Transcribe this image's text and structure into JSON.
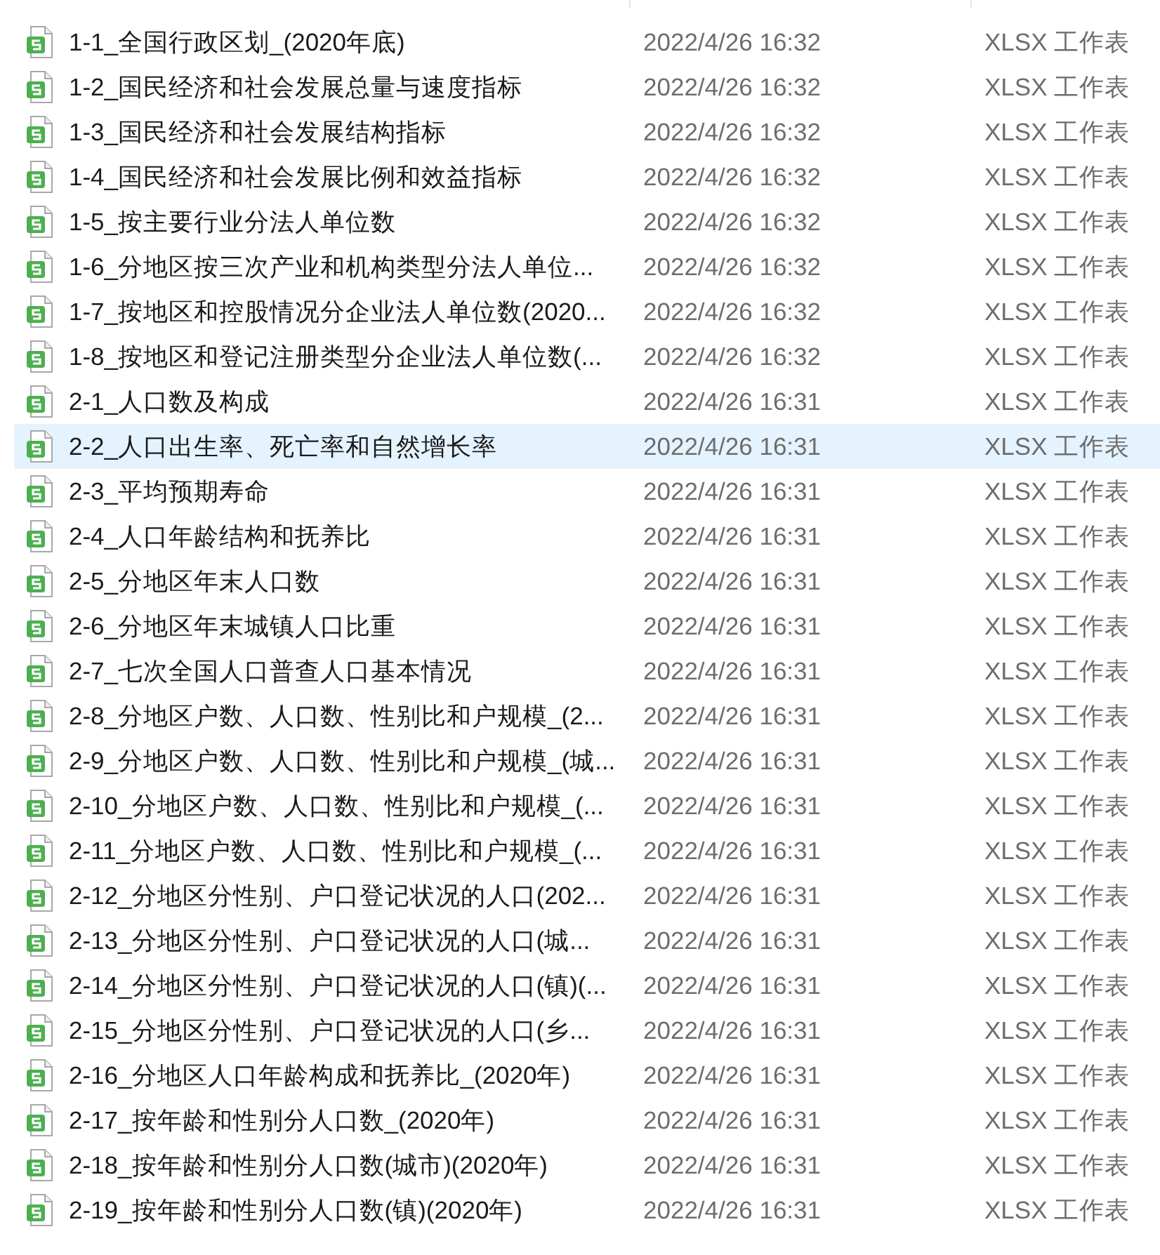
{
  "files": [
    {
      "name": "1-1_全国行政区划_(2020年底)",
      "modified": "2022/4/26 16:32",
      "type": "XLSX 工作表",
      "selected": false
    },
    {
      "name": "1-2_国民经济和社会发展总量与速度指标",
      "modified": "2022/4/26 16:32",
      "type": "XLSX 工作表",
      "selected": false
    },
    {
      "name": "1-3_国民经济和社会发展结构指标",
      "modified": "2022/4/26 16:32",
      "type": "XLSX 工作表",
      "selected": false
    },
    {
      "name": "1-4_国民经济和社会发展比例和效益指标",
      "modified": "2022/4/26 16:32",
      "type": "XLSX 工作表",
      "selected": false
    },
    {
      "name": "1-5_按主要行业分法人单位数",
      "modified": "2022/4/26 16:32",
      "type": "XLSX 工作表",
      "selected": false
    },
    {
      "name": "1-6_分地区按三次产业和机构类型分法人单位...",
      "modified": "2022/4/26 16:32",
      "type": "XLSX 工作表",
      "selected": false
    },
    {
      "name": "1-7_按地区和控股情况分企业法人单位数(2020...",
      "modified": "2022/4/26 16:32",
      "type": "XLSX 工作表",
      "selected": false
    },
    {
      "name": "1-8_按地区和登记注册类型分企业法人单位数(...",
      "modified": "2022/4/26 16:32",
      "type": "XLSX 工作表",
      "selected": false
    },
    {
      "name": "2-1_人口数及构成",
      "modified": "2022/4/26 16:31",
      "type": "XLSX 工作表",
      "selected": false
    },
    {
      "name": "2-2_人口出生率、死亡率和自然增长率",
      "modified": "2022/4/26 16:31",
      "type": "XLSX 工作表",
      "selected": true
    },
    {
      "name": "2-3_平均预期寿命",
      "modified": "2022/4/26 16:31",
      "type": "XLSX 工作表",
      "selected": false
    },
    {
      "name": "2-4_人口年龄结构和抚养比",
      "modified": "2022/4/26 16:31",
      "type": "XLSX 工作表",
      "selected": false
    },
    {
      "name": "2-5_分地区年末人口数",
      "modified": "2022/4/26 16:31",
      "type": "XLSX 工作表",
      "selected": false
    },
    {
      "name": "2-6_分地区年末城镇人口比重",
      "modified": "2022/4/26 16:31",
      "type": "XLSX 工作表",
      "selected": false
    },
    {
      "name": "2-7_七次全国人口普查人口基本情况",
      "modified": "2022/4/26 16:31",
      "type": "XLSX 工作表",
      "selected": false
    },
    {
      "name": "2-8_分地区户数、人口数、性别比和户规模_(2...",
      "modified": "2022/4/26 16:31",
      "type": "XLSX 工作表",
      "selected": false
    },
    {
      "name": "2-9_分地区户数、人口数、性别比和户规模_(城...",
      "modified": "2022/4/26 16:31",
      "type": "XLSX 工作表",
      "selected": false
    },
    {
      "name": "2-10_分地区户数、人口数、性别比和户规模_(...",
      "modified": "2022/4/26 16:31",
      "type": "XLSX 工作表",
      "selected": false
    },
    {
      "name": "2-11_分地区户数、人口数、性别比和户规模_(...",
      "modified": "2022/4/26 16:31",
      "type": "XLSX 工作表",
      "selected": false
    },
    {
      "name": "2-12_分地区分性别、户口登记状况的人口(202...",
      "modified": "2022/4/26 16:31",
      "type": "XLSX 工作表",
      "selected": false
    },
    {
      "name": "2-13_分地区分性别、户口登记状况的人口(城...",
      "modified": "2022/4/26 16:31",
      "type": "XLSX 工作表",
      "selected": false
    },
    {
      "name": "2-14_分地区分性别、户口登记状况的人口(镇)(...",
      "modified": "2022/4/26 16:31",
      "type": "XLSX 工作表",
      "selected": false
    },
    {
      "name": "2-15_分地区分性别、户口登记状况的人口(乡...",
      "modified": "2022/4/26 16:31",
      "type": "XLSX 工作表",
      "selected": false
    },
    {
      "name": "2-16_分地区人口年龄构成和抚养比_(2020年)",
      "modified": "2022/4/26 16:31",
      "type": "XLSX 工作表",
      "selected": false
    },
    {
      "name": "2-17_按年龄和性别分人口数_(2020年)",
      "modified": "2022/4/26 16:31",
      "type": "XLSX 工作表",
      "selected": false
    },
    {
      "name": "2-18_按年龄和性别分人口数(城市)(2020年)",
      "modified": "2022/4/26 16:31",
      "type": "XLSX 工作表",
      "selected": false
    },
    {
      "name": "2-19_按年龄和性别分人口数(镇)(2020年)",
      "modified": "2022/4/26 16:31",
      "type": "XLSX 工作表",
      "selected": false
    }
  ]
}
